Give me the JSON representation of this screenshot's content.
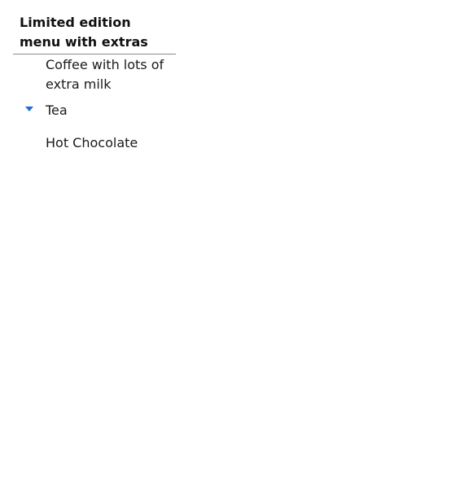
{
  "menu": {
    "title": "Limited edition menu with extras",
    "accent_color": "#1a6fd1",
    "items": [
      {
        "label": "Coffee with lots of extra milk",
        "expanded": false
      },
      {
        "label": "Tea",
        "expanded": true,
        "marker_icon": "caret-down-icon"
      },
      {
        "label": "Hot Chocolate",
        "expanded": false
      }
    ]
  }
}
